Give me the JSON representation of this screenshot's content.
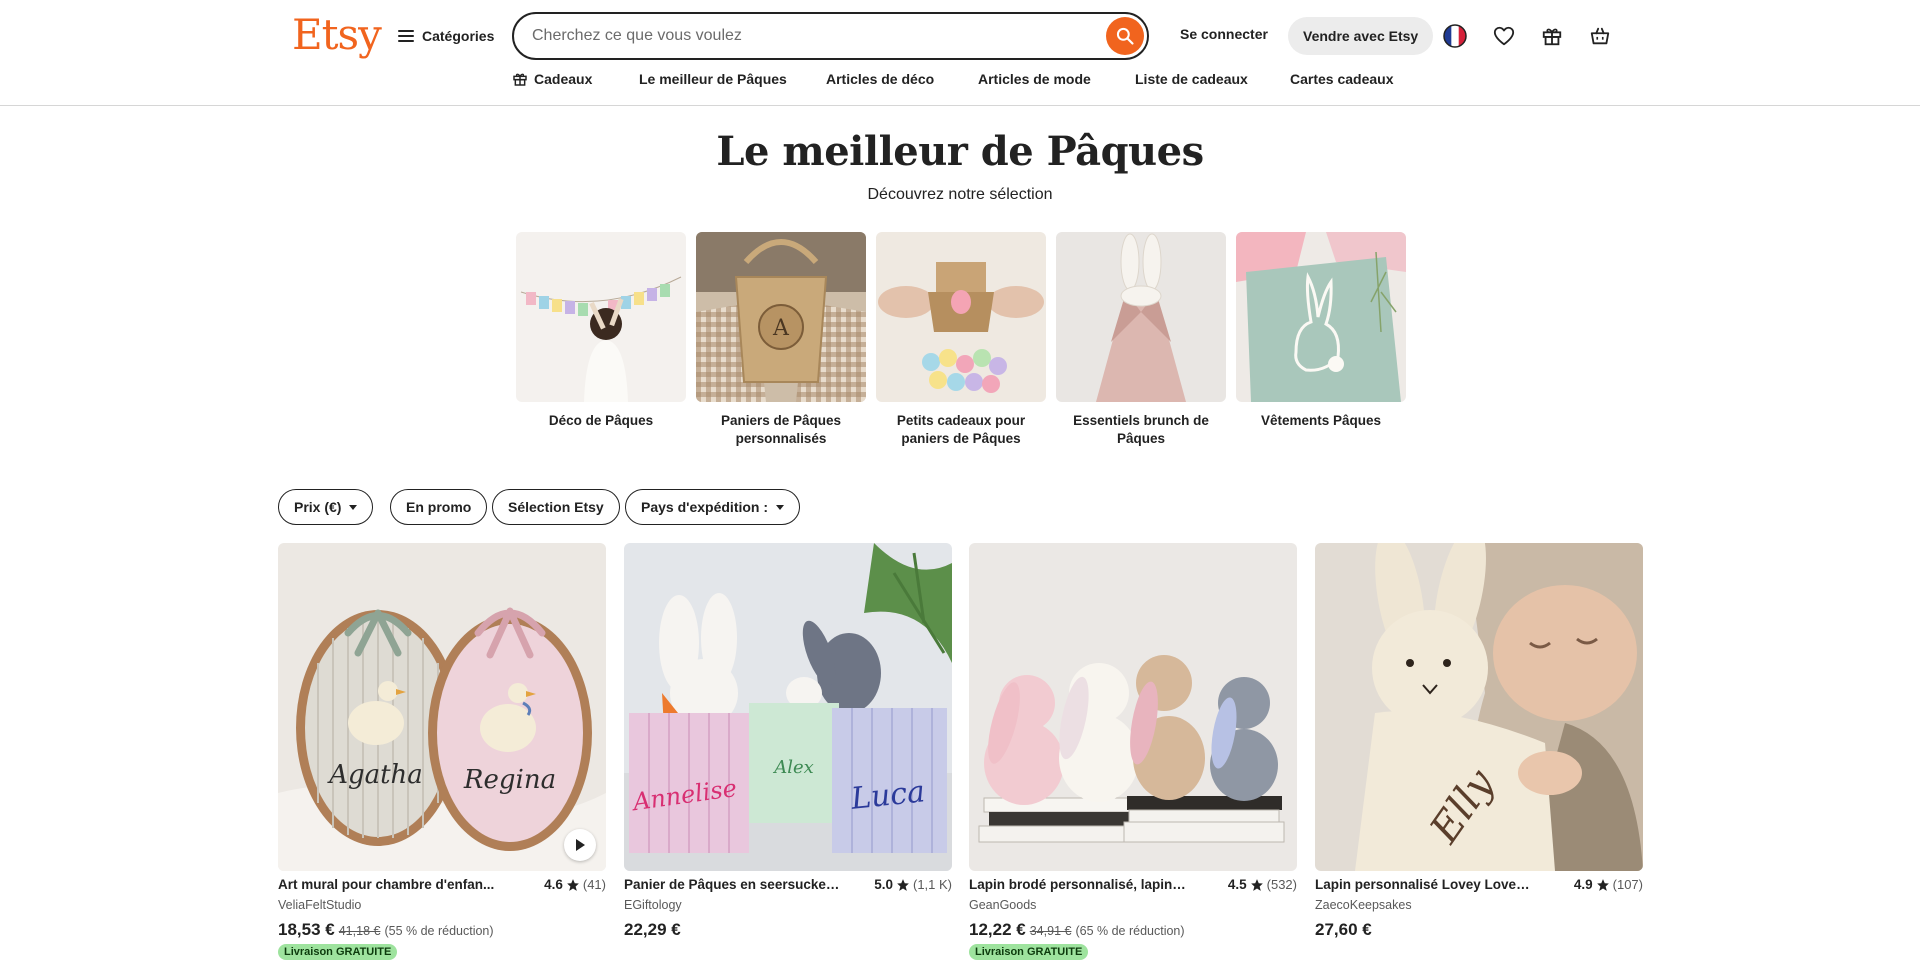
{
  "header": {
    "logo": "Etsy",
    "categories_label": "Catégories",
    "search_placeholder": "Cherchez ce que vous voulez",
    "signin_label": "Se connecter",
    "sell_label": "Vendre avec Etsy",
    "icons": [
      "flag-fr-icon",
      "heart-icon",
      "gift-icon",
      "cart-icon"
    ]
  },
  "nav": {
    "items": [
      {
        "label": "Cadeaux",
        "icon": "gift-icon"
      },
      {
        "label": "Le meilleur de Pâques"
      },
      {
        "label": "Articles de déco"
      },
      {
        "label": "Articles de mode"
      },
      {
        "label": "Liste de cadeaux"
      },
      {
        "label": "Cartes cadeaux"
      }
    ]
  },
  "hero": {
    "title": "Le meilleur de Pâques",
    "subtitle": "Découvrez notre sélection"
  },
  "categories": [
    {
      "label": "Déco de Pâques"
    },
    {
      "label": "Paniers de Pâques personnalisés"
    },
    {
      "label": "Petits cadeaux pour paniers de Pâques"
    },
    {
      "label": "Essentiels brunch de Pâques"
    },
    {
      "label": "Vêtements Pâques"
    }
  ],
  "filters": [
    {
      "label": "Prix (€)",
      "dropdown": true
    },
    {
      "label": "En promo",
      "dropdown": false
    },
    {
      "label": "Sélection Etsy",
      "dropdown": false
    },
    {
      "label": "Pays d'expédition :",
      "dropdown": true
    }
  ],
  "products": [
    {
      "title": "Art mural pour chambre d'enfan...",
      "rating": "4.6",
      "reviews": "(41)",
      "shop": "VeliaFeltStudio",
      "price": "18,53 €",
      "old_price": "41,18 €",
      "discount": "(55 % de réduction)",
      "badge": "Livraison GRATUITE",
      "video": true
    },
    {
      "title": "Panier de Pâques en seersucker,...",
      "rating": "5.0",
      "reviews": "(1,1 K)",
      "shop": "EGiftology",
      "price": "22,29 €",
      "old_price": "",
      "discount": "",
      "badge": "",
      "video": false
    },
    {
      "title": "Lapin brodé personnalisé, lapin ...",
      "rating": "4.5",
      "reviews": "(532)",
      "shop": "GeanGoods",
      "price": "12,22 €",
      "old_price": "34,91 €",
      "discount": "(65 % de réduction)",
      "badge": "Livraison GRATUITE",
      "video": false
    },
    {
      "title": "Lapin personnalisé Lovey Lovey ...",
      "rating": "4.9",
      "reviews": "(107)",
      "shop": "ZaecoKeepsakes",
      "price": "27,60 €",
      "old_price": "",
      "discount": "",
      "badge": "",
      "video": false
    }
  ],
  "embroidery_names": [
    "Agatha",
    "Regina",
    "Annelise",
    "Alex",
    "Luca",
    "Elly"
  ],
  "colors": {
    "brand": "#f1641e",
    "badge_bg": "#9ee39e"
  }
}
